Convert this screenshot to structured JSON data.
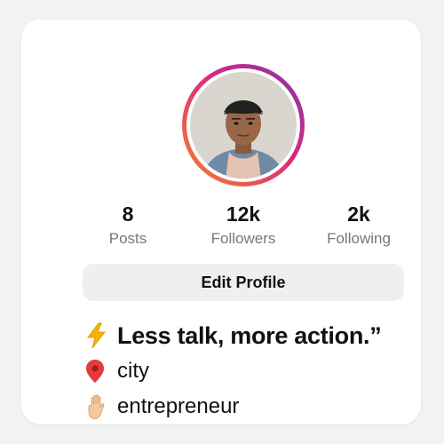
{
  "profile": {
    "avatar_ring_colors": [
      "#f58529",
      "#dd2a7b",
      "#8134af"
    ],
    "stats": [
      {
        "value": "8",
        "label": "Posts"
      },
      {
        "value": "12k",
        "label": "Followers"
      },
      {
        "value": "2k",
        "label": "Following"
      }
    ],
    "edit_button_label": "Edit Profile",
    "bio": {
      "quote": "Less talk, more action.”",
      "quote_icon": "lightning-icon",
      "location": "city",
      "location_icon": "location-pin-icon",
      "occupation": "entrepreneur",
      "occupation_icon": "raised-hand-icon"
    }
  }
}
